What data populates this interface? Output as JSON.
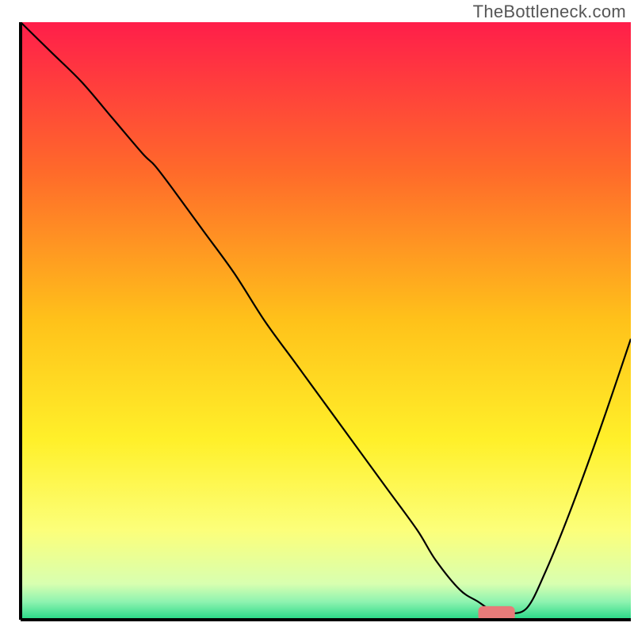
{
  "watermark": "TheBottleneck.com",
  "chart_data": {
    "type": "line",
    "title": "",
    "xlabel": "",
    "ylabel": "",
    "xlim": [
      0,
      100
    ],
    "ylim": [
      0,
      100
    ],
    "grid": false,
    "legend": false,
    "background_gradient": {
      "type": "vertical",
      "stops": [
        {
          "pos": 0.0,
          "color": "#ff1e4a"
        },
        {
          "pos": 0.25,
          "color": "#ff6a2a"
        },
        {
          "pos": 0.5,
          "color": "#ffc21a"
        },
        {
          "pos": 0.7,
          "color": "#fff02a"
        },
        {
          "pos": 0.85,
          "color": "#fcff7a"
        },
        {
          "pos": 0.94,
          "color": "#d8ffb0"
        },
        {
          "pos": 0.97,
          "color": "#8ef3b0"
        },
        {
          "pos": 1.0,
          "color": "#25d886"
        }
      ]
    },
    "series": [
      {
        "name": "bottleneck-curve",
        "color": "#000000",
        "x": [
          0,
          5,
          10,
          15,
          20,
          22,
          25,
          30,
          35,
          40,
          45,
          50,
          55,
          60,
          65,
          68,
          72,
          75,
          78,
          80,
          83,
          86,
          90,
          95,
          100
        ],
        "y": [
          100,
          95,
          90,
          84,
          78,
          76,
          72,
          65,
          58,
          50,
          43,
          36,
          29,
          22,
          15,
          10,
          5,
          3,
          1,
          1,
          2,
          8,
          18,
          32,
          47
        ]
      }
    ],
    "marker": {
      "name": "optimal-region",
      "shape": "rounded-bar",
      "color": "#e77b79",
      "x_start": 75,
      "x_end": 81,
      "y": 0,
      "height": 2
    },
    "axes_color": "#000000",
    "axes_width": 4
  }
}
